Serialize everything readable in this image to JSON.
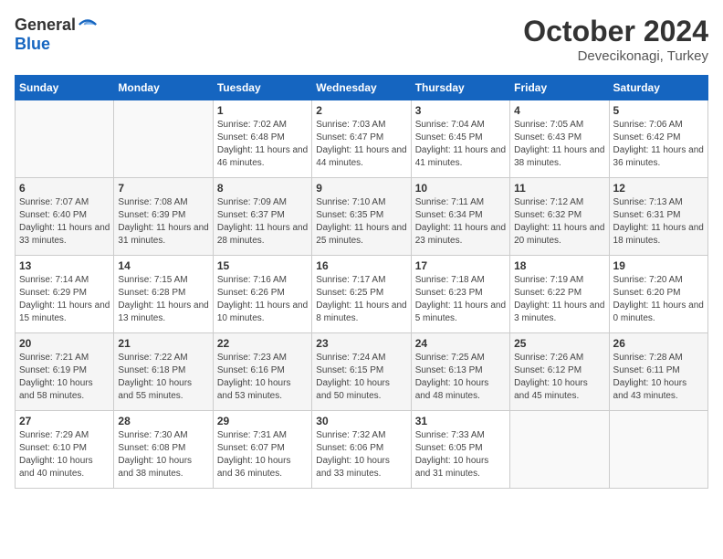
{
  "header": {
    "logo_general": "General",
    "logo_blue": "Blue",
    "month": "October 2024",
    "location": "Devecikonagi, Turkey"
  },
  "weekdays": [
    "Sunday",
    "Monday",
    "Tuesday",
    "Wednesday",
    "Thursday",
    "Friday",
    "Saturday"
  ],
  "weeks": [
    [
      {
        "day": null
      },
      {
        "day": null
      },
      {
        "day": "1",
        "sunrise": "Sunrise: 7:02 AM",
        "sunset": "Sunset: 6:48 PM",
        "daylight": "Daylight: 11 hours and 46 minutes."
      },
      {
        "day": "2",
        "sunrise": "Sunrise: 7:03 AM",
        "sunset": "Sunset: 6:47 PM",
        "daylight": "Daylight: 11 hours and 44 minutes."
      },
      {
        "day": "3",
        "sunrise": "Sunrise: 7:04 AM",
        "sunset": "Sunset: 6:45 PM",
        "daylight": "Daylight: 11 hours and 41 minutes."
      },
      {
        "day": "4",
        "sunrise": "Sunrise: 7:05 AM",
        "sunset": "Sunset: 6:43 PM",
        "daylight": "Daylight: 11 hours and 38 minutes."
      },
      {
        "day": "5",
        "sunrise": "Sunrise: 7:06 AM",
        "sunset": "Sunset: 6:42 PM",
        "daylight": "Daylight: 11 hours and 36 minutes."
      }
    ],
    [
      {
        "day": "6",
        "sunrise": "Sunrise: 7:07 AM",
        "sunset": "Sunset: 6:40 PM",
        "daylight": "Daylight: 11 hours and 33 minutes."
      },
      {
        "day": "7",
        "sunrise": "Sunrise: 7:08 AM",
        "sunset": "Sunset: 6:39 PM",
        "daylight": "Daylight: 11 hours and 31 minutes."
      },
      {
        "day": "8",
        "sunrise": "Sunrise: 7:09 AM",
        "sunset": "Sunset: 6:37 PM",
        "daylight": "Daylight: 11 hours and 28 minutes."
      },
      {
        "day": "9",
        "sunrise": "Sunrise: 7:10 AM",
        "sunset": "Sunset: 6:35 PM",
        "daylight": "Daylight: 11 hours and 25 minutes."
      },
      {
        "day": "10",
        "sunrise": "Sunrise: 7:11 AM",
        "sunset": "Sunset: 6:34 PM",
        "daylight": "Daylight: 11 hours and 23 minutes."
      },
      {
        "day": "11",
        "sunrise": "Sunrise: 7:12 AM",
        "sunset": "Sunset: 6:32 PM",
        "daylight": "Daylight: 11 hours and 20 minutes."
      },
      {
        "day": "12",
        "sunrise": "Sunrise: 7:13 AM",
        "sunset": "Sunset: 6:31 PM",
        "daylight": "Daylight: 11 hours and 18 minutes."
      }
    ],
    [
      {
        "day": "13",
        "sunrise": "Sunrise: 7:14 AM",
        "sunset": "Sunset: 6:29 PM",
        "daylight": "Daylight: 11 hours and 15 minutes."
      },
      {
        "day": "14",
        "sunrise": "Sunrise: 7:15 AM",
        "sunset": "Sunset: 6:28 PM",
        "daylight": "Daylight: 11 hours and 13 minutes."
      },
      {
        "day": "15",
        "sunrise": "Sunrise: 7:16 AM",
        "sunset": "Sunset: 6:26 PM",
        "daylight": "Daylight: 11 hours and 10 minutes."
      },
      {
        "day": "16",
        "sunrise": "Sunrise: 7:17 AM",
        "sunset": "Sunset: 6:25 PM",
        "daylight": "Daylight: 11 hours and 8 minutes."
      },
      {
        "day": "17",
        "sunrise": "Sunrise: 7:18 AM",
        "sunset": "Sunset: 6:23 PM",
        "daylight": "Daylight: 11 hours and 5 minutes."
      },
      {
        "day": "18",
        "sunrise": "Sunrise: 7:19 AM",
        "sunset": "Sunset: 6:22 PM",
        "daylight": "Daylight: 11 hours and 3 minutes."
      },
      {
        "day": "19",
        "sunrise": "Sunrise: 7:20 AM",
        "sunset": "Sunset: 6:20 PM",
        "daylight": "Daylight: 11 hours and 0 minutes."
      }
    ],
    [
      {
        "day": "20",
        "sunrise": "Sunrise: 7:21 AM",
        "sunset": "Sunset: 6:19 PM",
        "daylight": "Daylight: 10 hours and 58 minutes."
      },
      {
        "day": "21",
        "sunrise": "Sunrise: 7:22 AM",
        "sunset": "Sunset: 6:18 PM",
        "daylight": "Daylight: 10 hours and 55 minutes."
      },
      {
        "day": "22",
        "sunrise": "Sunrise: 7:23 AM",
        "sunset": "Sunset: 6:16 PM",
        "daylight": "Daylight: 10 hours and 53 minutes."
      },
      {
        "day": "23",
        "sunrise": "Sunrise: 7:24 AM",
        "sunset": "Sunset: 6:15 PM",
        "daylight": "Daylight: 10 hours and 50 minutes."
      },
      {
        "day": "24",
        "sunrise": "Sunrise: 7:25 AM",
        "sunset": "Sunset: 6:13 PM",
        "daylight": "Daylight: 10 hours and 48 minutes."
      },
      {
        "day": "25",
        "sunrise": "Sunrise: 7:26 AM",
        "sunset": "Sunset: 6:12 PM",
        "daylight": "Daylight: 10 hours and 45 minutes."
      },
      {
        "day": "26",
        "sunrise": "Sunrise: 7:28 AM",
        "sunset": "Sunset: 6:11 PM",
        "daylight": "Daylight: 10 hours and 43 minutes."
      }
    ],
    [
      {
        "day": "27",
        "sunrise": "Sunrise: 7:29 AM",
        "sunset": "Sunset: 6:10 PM",
        "daylight": "Daylight: 10 hours and 40 minutes."
      },
      {
        "day": "28",
        "sunrise": "Sunrise: 7:30 AM",
        "sunset": "Sunset: 6:08 PM",
        "daylight": "Daylight: 10 hours and 38 minutes."
      },
      {
        "day": "29",
        "sunrise": "Sunrise: 7:31 AM",
        "sunset": "Sunset: 6:07 PM",
        "daylight": "Daylight: 10 hours and 36 minutes."
      },
      {
        "day": "30",
        "sunrise": "Sunrise: 7:32 AM",
        "sunset": "Sunset: 6:06 PM",
        "daylight": "Daylight: 10 hours and 33 minutes."
      },
      {
        "day": "31",
        "sunrise": "Sunrise: 7:33 AM",
        "sunset": "Sunset: 6:05 PM",
        "daylight": "Daylight: 10 hours and 31 minutes."
      },
      {
        "day": null
      },
      {
        "day": null
      }
    ]
  ]
}
